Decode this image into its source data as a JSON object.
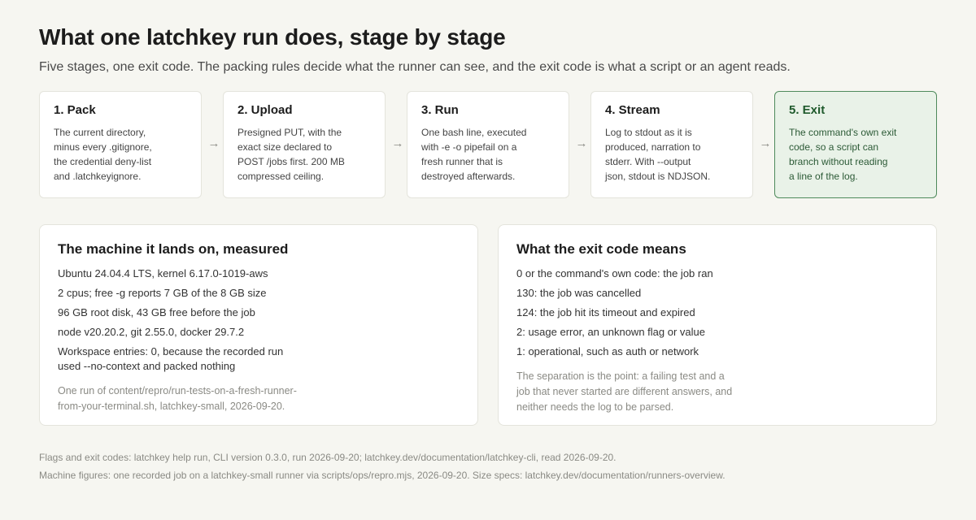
{
  "header": {
    "title": "What one latchkey run does, stage by stage",
    "subtitle": "Five stages, one exit code. The packing rules decide what the runner can see, and the exit code is what a script or an agent reads."
  },
  "stages": [
    {
      "title": "1. Pack",
      "body": "The current directory,\nminus every .gitignore,\nthe credential deny-list\nand .latchkeyignore."
    },
    {
      "title": "2. Upload",
      "body": "Presigned PUT, with the\nexact size declared to\nPOST /jobs first. 200 MB\ncompressed ceiling."
    },
    {
      "title": "3. Run",
      "body": "One bash line, executed\nwith -e -o pipefail on a\nfresh runner that is\ndestroyed afterwards."
    },
    {
      "title": "4. Stream",
      "body": "Log to stdout as it is\nproduced, narration to\nstderr. With --output\njson, stdout is NDJSON."
    },
    {
      "title": "5. Exit",
      "body": "The command's own exit\ncode, so a script can\nbranch without reading\na line of the log."
    }
  ],
  "arrow_glyph": "→",
  "machine_panel": {
    "title": "The machine it lands on, measured",
    "items": [
      "Ubuntu 24.04.4 LTS, kernel 6.17.0-1019-aws",
      "2 cpus; free -g reports 7 GB of the 8 GB size",
      "96 GB root disk, 43 GB free before the job",
      "node v20.20.2, git 2.55.0, docker 29.7.2",
      "Workspace entries: 0, because the recorded run\nused --no-context and packed nothing"
    ],
    "note": "One run of content/repro/run-tests-on-a-fresh-runner-\nfrom-your-terminal.sh, latchkey-small, 2026-09-20."
  },
  "exit_panel": {
    "title": "What the exit code means",
    "items": [
      "0 or the command's own code: the job ran",
      "130: the job was cancelled",
      "124: the job hit its timeout and expired",
      "2: usage error, an unknown flag or value",
      "1: operational, such as auth or network"
    ],
    "note": "The separation is the point: a failing test and a\njob that never started are different answers, and\nneither needs the log to be parsed."
  },
  "footnotes": [
    "Flags and exit codes: latchkey help run, CLI version 0.3.0, run 2026-09-20; latchkey.dev/documentation/latchkey-cli, read 2026-09-20.",
    "Machine figures: one recorded job on a latchkey-small runner via scripts/ops/repro.mjs, 2026-09-20. Size specs: latchkey.dev/documentation/runners-overview."
  ]
}
